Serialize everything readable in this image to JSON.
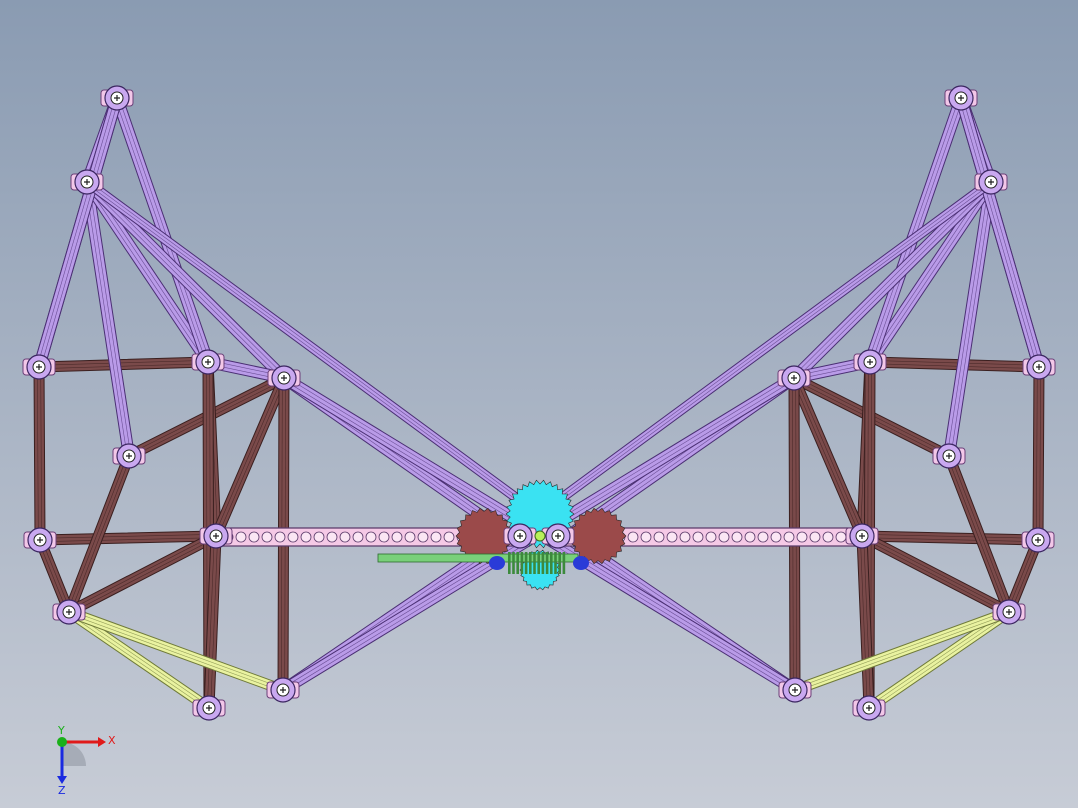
{
  "viewport": {
    "background_top": "#8a9bb2",
    "background_bottom": "#c7ccd6"
  },
  "colors": {
    "purple_link": "#b99be8",
    "purple_dark": "#4a2f73",
    "pink_connector": "#f2c7e8",
    "maroon_link": "#7a4a4a",
    "yellow_link": "#e9f2a0",
    "beam_fill": "#f5c9e6",
    "cyan_gear": "#3ae2f2",
    "brown_gear": "#9b4a4a",
    "green_shaft": "#79d07a",
    "blue_part": "#2a3bd8"
  },
  "triad": {
    "x_label": "X",
    "y_label": "Y",
    "z_label": "Z",
    "x_color": "#e01a1a",
    "y_color": "#1ab01a",
    "z_color": "#1a2ae0"
  }
}
